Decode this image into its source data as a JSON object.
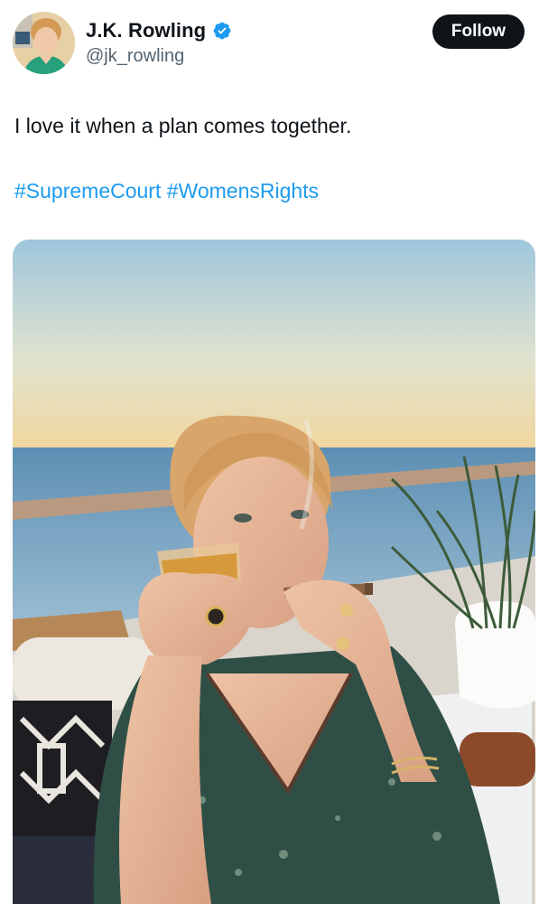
{
  "author": {
    "display_name": "J.K. Rowling",
    "handle": "@jk_rowling",
    "verified": true,
    "verified_icon": "verified-badge-icon",
    "verified_color": "#1d9bf0"
  },
  "actions": {
    "follow_label": "Follow"
  },
  "tweet": {
    "text": "I love it when a plan comes together.",
    "hashtags": [
      "#SupremeCourt",
      "#WomensRights"
    ]
  },
  "colors": {
    "text": "#0f1419",
    "secondary_text": "#536471",
    "link": "#1d9bf0",
    "button_bg": "#0f1419",
    "button_text": "#ffffff"
  }
}
